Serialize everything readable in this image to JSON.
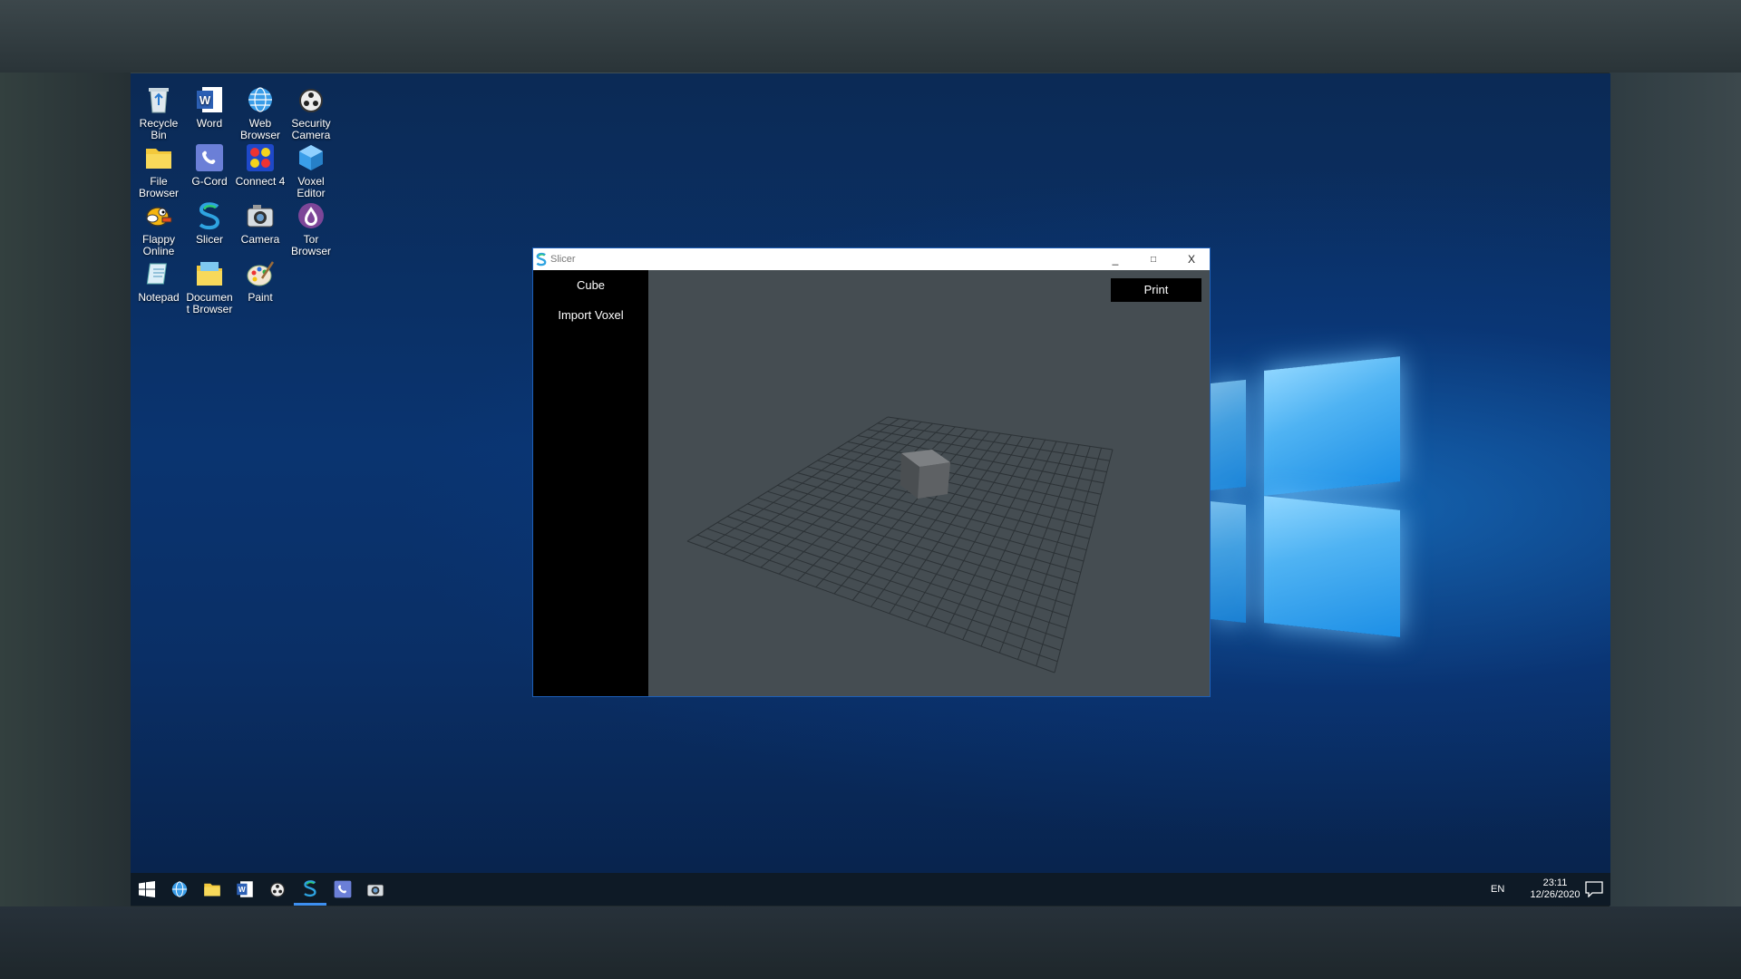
{
  "desktop": {
    "icons": [
      {
        "label": "Recycle Bin",
        "icon": "recycle-bin-icon"
      },
      {
        "label": "Word",
        "icon": "word-icon"
      },
      {
        "label": "Web Browser",
        "icon": "globe-icon"
      },
      {
        "label": "Security Camera",
        "icon": "camera-reel-icon"
      },
      {
        "label": "File Browser",
        "icon": "folder-icon"
      },
      {
        "label": "G-Cord",
        "icon": "phone-icon"
      },
      {
        "label": "Connect 4",
        "icon": "connect4-icon"
      },
      {
        "label": "Voxel Editor",
        "icon": "cube-icon"
      },
      {
        "label": "Flappy Online",
        "icon": "bird-icon"
      },
      {
        "label": "Slicer",
        "icon": "slicer-icon"
      },
      {
        "label": "Camera",
        "icon": "camera-icon"
      },
      {
        "label": "Tor Browser",
        "icon": "onion-icon"
      },
      {
        "label": "Notepad",
        "icon": "notepad-icon"
      },
      {
        "label": "Documen t Browser",
        "icon": "document-folder-icon"
      },
      {
        "label": "Paint",
        "icon": "paint-palette-icon"
      }
    ]
  },
  "window": {
    "title": "Slicer",
    "minimize": "_",
    "maximize": "□",
    "close": "X",
    "sidebar": [
      "Cube",
      "Import Voxel"
    ],
    "print_label": "Print"
  },
  "taskbar": {
    "apps": [
      "windows-start-icon",
      "globe-icon",
      "folder-icon",
      "word-icon",
      "camera-reel-icon",
      "slicer-icon",
      "phone-icon",
      "camera-icon"
    ],
    "active_app": "slicer-icon",
    "language": "EN",
    "time": "23:11",
    "date": "12/26/2020"
  },
  "colors": {
    "accent": "#3d8ff0",
    "window_border": "#1d5fb8",
    "viewport_bg": "#454d52"
  }
}
